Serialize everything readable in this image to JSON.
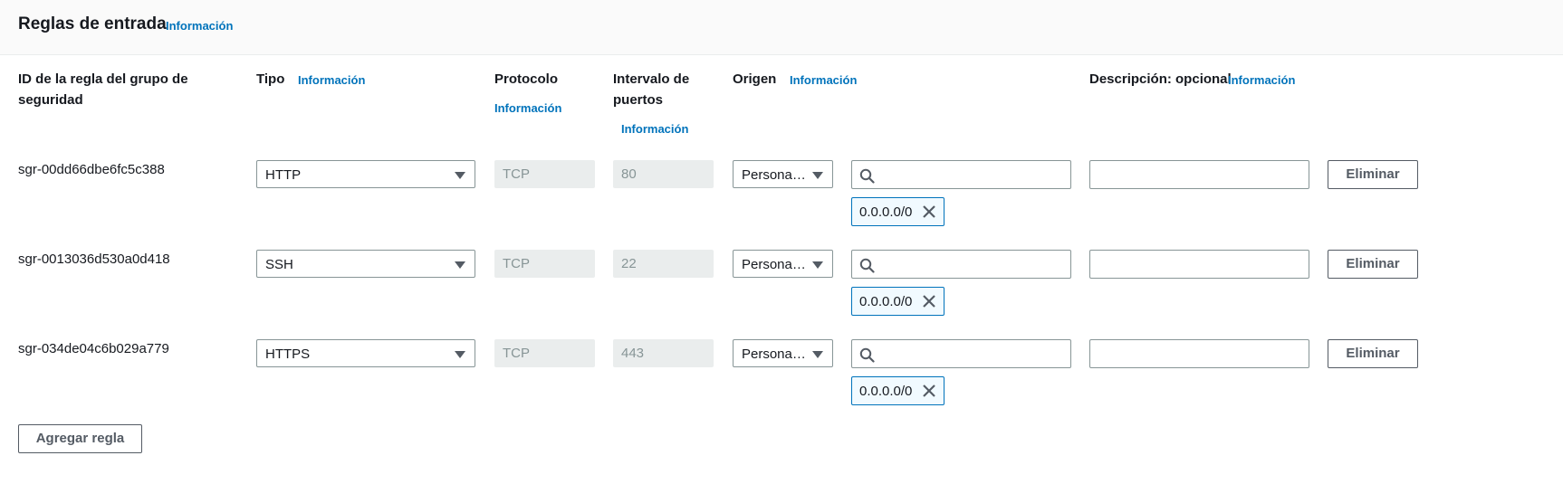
{
  "section": {
    "title": "Reglas de entrada",
    "info": "Información"
  },
  "columns": {
    "rule_id": "ID de la regla del grupo de seguridad",
    "type": "Tipo",
    "type_info": "Información",
    "protocol": "Protocolo",
    "protocol_info": "Información",
    "port_range": "Intervalo de puertos",
    "port_range_info": "Información",
    "source": "Origen",
    "source_info": "Información",
    "description": "Descripción: opcional",
    "description_info": "Información"
  },
  "rules": [
    {
      "id": "sgr-00dd66dbe6fc5c388",
      "type": "HTTP",
      "protocol": "TCP",
      "port": "80",
      "source_mode": "Persona…",
      "search_value": "",
      "cidr": "0.0.0.0/0",
      "description": "",
      "delete": "Eliminar"
    },
    {
      "id": "sgr-0013036d530a0d418",
      "type": "SSH",
      "protocol": "TCP",
      "port": "22",
      "source_mode": "Persona…",
      "search_value": "",
      "cidr": "0.0.0.0/0",
      "description": "",
      "delete": "Eliminar"
    },
    {
      "id": "sgr-034de04c6b029a779",
      "type": "HTTPS",
      "protocol": "TCP",
      "port": "443",
      "source_mode": "Persona…",
      "search_value": "",
      "cidr": "0.0.0.0/0",
      "description": "",
      "delete": "Eliminar"
    }
  ],
  "add_rule": "Agregar regla",
  "icons": {
    "search": "search-icon",
    "remove_token": "close-icon",
    "dropdown": "caret-down-icon"
  },
  "colors": {
    "link": "#0073bb",
    "border": "#879596",
    "disabled_bg": "#eaeded"
  }
}
